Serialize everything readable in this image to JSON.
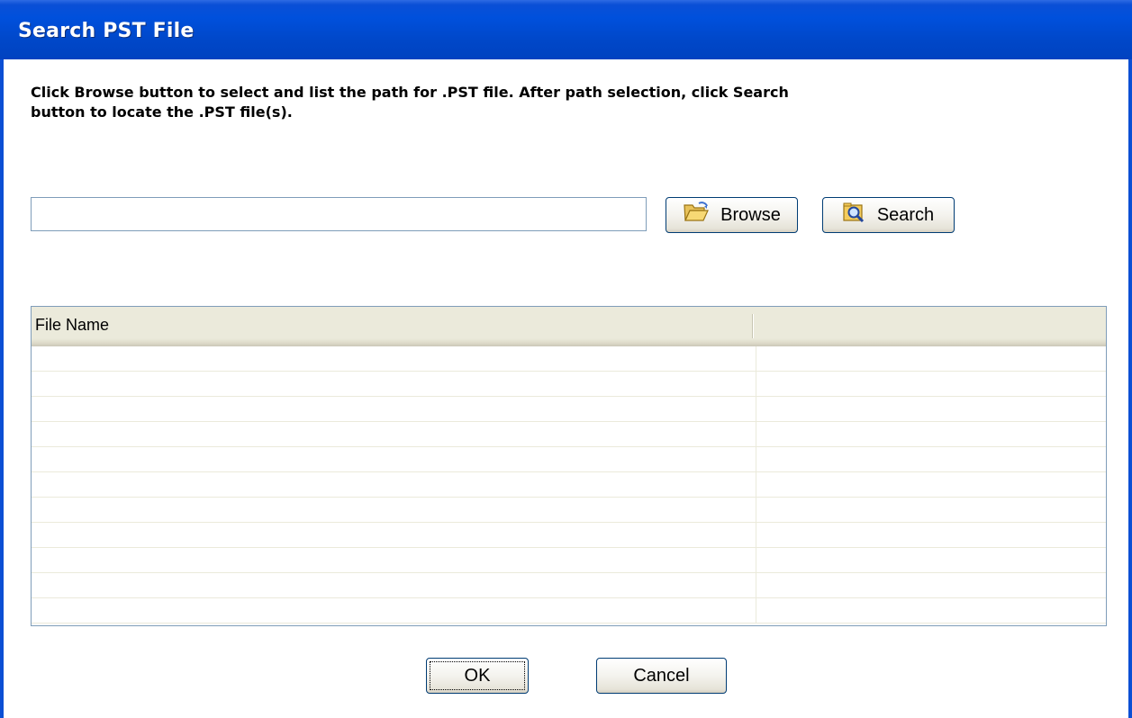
{
  "window": {
    "title": "Search PST File"
  },
  "instructions": "Click Browse button to select and list the path for .PST file. After path selection, click Search button to locate the .PST file(s).",
  "path_input": {
    "value": "",
    "placeholder": ""
  },
  "buttons": {
    "browse": {
      "label": "Browse",
      "icon": "folder-open-icon"
    },
    "search": {
      "label": "Search",
      "icon": "search-folder-icon"
    },
    "ok": {
      "label": "OK"
    },
    "cancel": {
      "label": "Cancel"
    }
  },
  "file_list": {
    "columns": [
      "File Name",
      ""
    ],
    "rows": []
  },
  "colors": {
    "titlebar": "#0050dc",
    "title_text": "#ffffff",
    "header_bg": "#ebeadb",
    "border": "#7f9db9"
  }
}
